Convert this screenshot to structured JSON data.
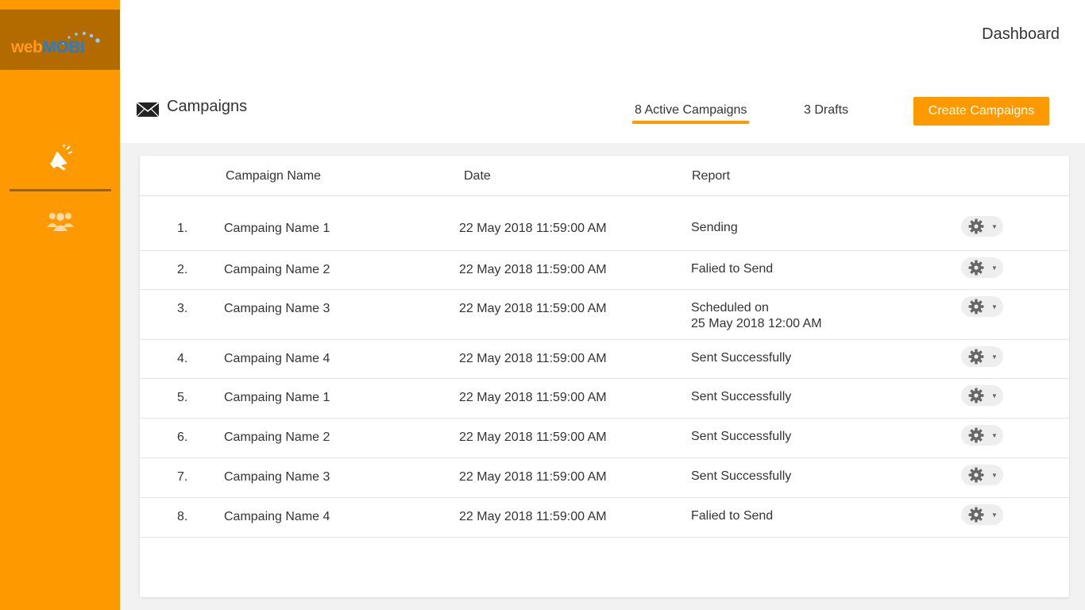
{
  "brand": {
    "web": "web",
    "mobi": "MOBI"
  },
  "header": {
    "dashboard": "Dashboard",
    "title": "Campaigns",
    "tabs": {
      "active": "8 Active Campaigns",
      "drafts": "3 Drafts"
    },
    "create_button": "Create Campaigns"
  },
  "sidebar": {
    "items": [
      {
        "icon": "megaphone-icon",
        "name": "campaigns"
      },
      {
        "icon": "users-icon",
        "name": "users"
      }
    ]
  },
  "table": {
    "headers": {
      "name": "Campaign Name",
      "date": "Date",
      "report": "Report"
    },
    "rows": [
      {
        "num": "1.",
        "name": "Campaing Name 1",
        "date": "22 May 2018 11:59:00 AM",
        "report": "Sending",
        "report2": ""
      },
      {
        "num": "2.",
        "name": "Campaing Name 2",
        "date": "22 May 2018 11:59:00 AM",
        "report": "Falied to Send",
        "report2": ""
      },
      {
        "num": "3.",
        "name": "Campaing Name 3",
        "date": "22 May 2018 11:59:00 AM",
        "report": "Scheduled on",
        "report2": "25 May 2018 12:00 AM"
      },
      {
        "num": "4.",
        "name": "Campaing Name 4",
        "date": "22 May 2018 11:59:00 AM",
        "report": "Sent Successfully",
        "report2": ""
      },
      {
        "num": "5.",
        "name": "Campaing Name 1",
        "date": "22 May 2018 11:59:00 AM",
        "report": "Sent Successfully",
        "report2": ""
      },
      {
        "num": "6.",
        "name": "Campaing Name 2",
        "date": "22 May 2018 11:59:00 AM",
        "report": "Sent Successfully",
        "report2": ""
      },
      {
        "num": "7.",
        "name": "Campaing Name 3",
        "date": "22 May 2018 11:59:00 AM",
        "report": "Sent Successfully",
        "report2": ""
      },
      {
        "num": "8.",
        "name": "Campaing Name 4",
        "date": "22 May 2018 11:59:00 AM",
        "report": "Falied to Send",
        "report2": ""
      }
    ]
  },
  "colors": {
    "accent": "#ff9900",
    "logo_bg": "#b36b00",
    "mobi_blue": "#1f7fd6"
  }
}
